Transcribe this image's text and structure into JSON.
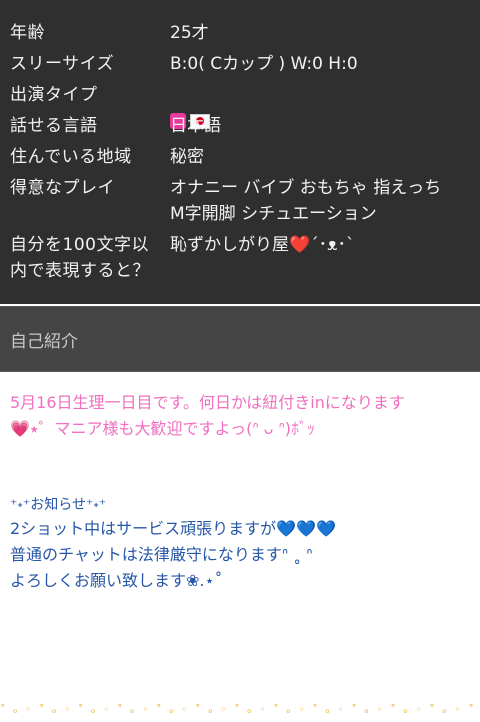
{
  "profile": {
    "rows": [
      {
        "label": "年齢",
        "value": "25才"
      },
      {
        "label": "スリーサイズ",
        "value": "B:0( Cカップ ) W:0 H:0"
      },
      {
        "label": "出演タイプ",
        "value": ""
      },
      {
        "label": "話せる言語",
        "value": "日本語"
      },
      {
        "label": "住んでいる地域",
        "value": "秘密"
      },
      {
        "label": "得意なプレイ",
        "value": "オナニー バイブ おもちゃ 指えっち\nM字開脚 シチュエーション"
      },
      {
        "label": "自分を100文字以\n内で表現すると？",
        "value": "恥ずかしがり屋❤️´･ᴥ･`"
      }
    ],
    "type_icons": [
      "pink-person-icon",
      "japan-flag-icon"
    ]
  },
  "section": {
    "title": "自己紹介"
  },
  "intro": {
    "line1": "5月16日生理一日目です。何日かは紐付きinになります",
    "line2": "💗⭑゜マニア様も大歓迎ですよっ(ᐢ ᴗ ᐢ)ﾎﾞｯ",
    "notice_title": "⁺˖⁺お知らせ⁺˖⁺",
    "notice_line1": "2ショット中はサービス頑張りますが",
    "notice_hearts": "💙💙💙",
    "notice_line2": "普通のチャットは法律厳守になりますᐢ ˳ ᐢ",
    "notice_line3": "よろしくお願い致します❀.⋆˚",
    "dots": "˚ ₒ ◦ ˚ ₒ ◦ ˚ ₒ ◦ ˚ ₒ ◦ ˚ ₒ ◦ ˚ ₒ ◦ ˚ ₒ ◦ ˚ ₒ ◦ ˚ ₒ ◦ ˚ ₒ ◦ ˚ ₒ ◦ ˚ ₒ ◦ ˚ ₒ ◦ ˚"
  }
}
